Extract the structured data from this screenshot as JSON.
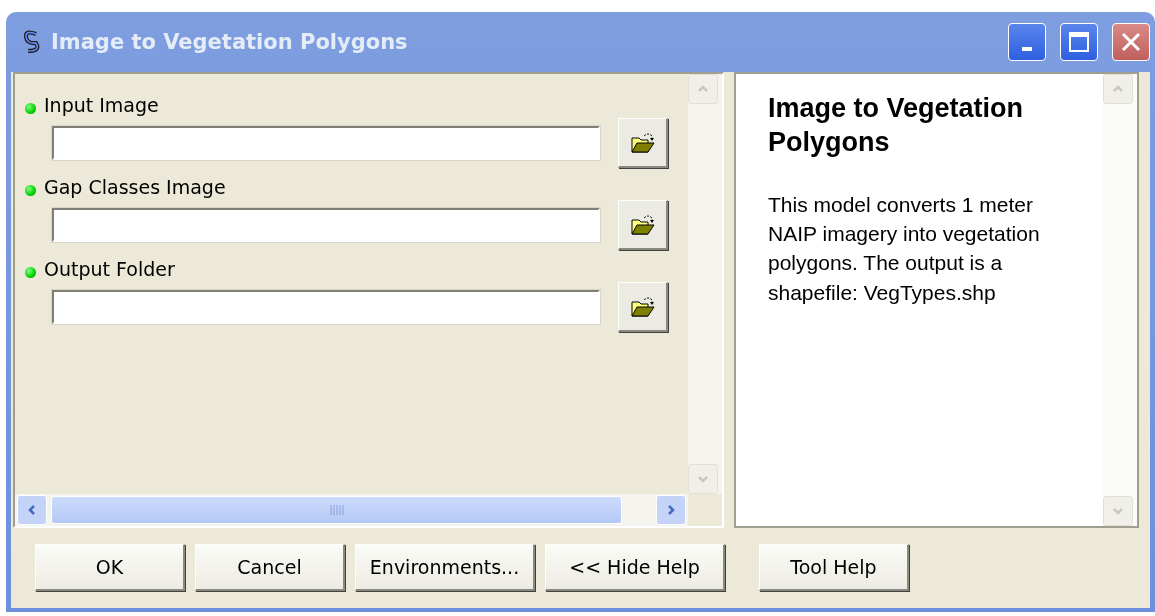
{
  "window": {
    "title": "Image to Vegetation Polygons"
  },
  "parameters": [
    {
      "label": "Input Image"
    },
    {
      "label": "Gap Classes Image"
    },
    {
      "label": "Output Folder"
    }
  ],
  "help": {
    "title": "Image to Vegetation Polygons",
    "text": "This model converts 1 meter NAIP imagery into vegetation polygons. The output is a shapefile: VegTypes.shp"
  },
  "buttons": [
    "OK",
    "Cancel",
    "Environments...",
    "<< Hide Help",
    "Tool Help"
  ]
}
